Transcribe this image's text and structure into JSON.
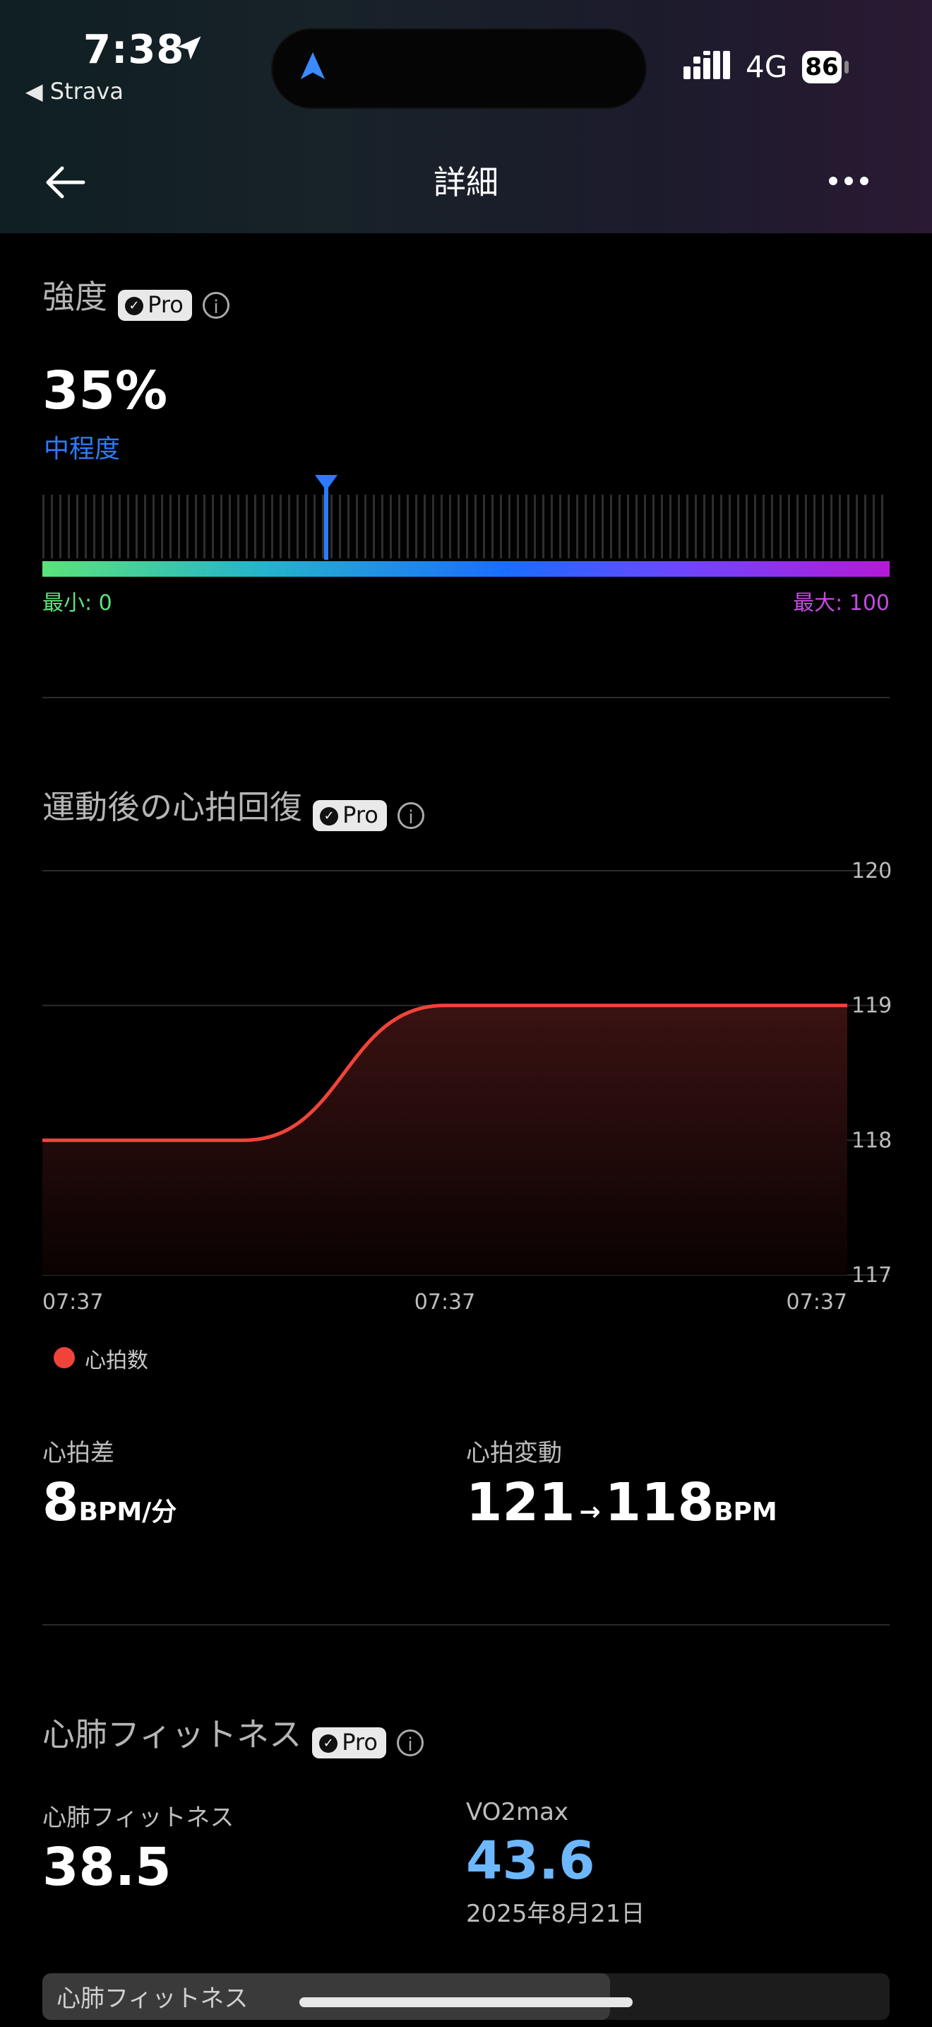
{
  "status_bar": {
    "time": "7:38",
    "back_app": "◀ Strava",
    "network": "4G",
    "battery": "86"
  },
  "header": {
    "title": "詳細"
  },
  "intensity": {
    "title": "強度",
    "pro_label": "Pro",
    "value": "35%",
    "level": "中程度",
    "min_label": "最小: 0",
    "max_label": "最大: 100",
    "value_fraction": 0.35
  },
  "recovery": {
    "title": "運動後の心拍回復",
    "pro_label": "Pro",
    "legend_label": "心拍数",
    "diff_label": "心拍差",
    "diff_value": "8",
    "diff_unit": "BPM/分",
    "change_label": "心拍変動",
    "change_from": "121",
    "change_to": "118",
    "change_unit": "BPM"
  },
  "chart_data": {
    "type": "area",
    "x": [
      "07:37",
      "07:37",
      "07:37"
    ],
    "series": [
      {
        "name": "心拍数",
        "values": [
          118,
          118,
          119,
          119,
          119
        ]
      }
    ],
    "y_ticks": [
      120,
      119,
      118,
      117
    ],
    "ylim": [
      117,
      120
    ],
    "grid": true,
    "legend_position": "bottom-left",
    "color": "#f0443a"
  },
  "fitness": {
    "title": "心肺フィットネス",
    "pro_label": "Pro",
    "cardio_label": "心肺フィットネス",
    "cardio_value": "38.5",
    "vo2_label": "VO2max",
    "vo2_value": "43.6",
    "date": "2025年8月21日",
    "bar_label": "心肺フィットネス"
  }
}
